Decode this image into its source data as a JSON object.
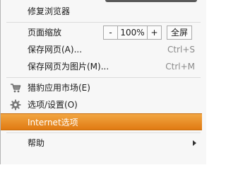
{
  "menu": {
    "repair_browser": "修复浏览器",
    "zoom": {
      "label": "页面缩放",
      "minus": "-",
      "value": "100%",
      "plus": "+",
      "fullscreen": "全屏"
    },
    "save_page": {
      "label": "保存网页(A)...",
      "shortcut": "Ctrl+S"
    },
    "save_as_image": {
      "label": "保存网页为图片(M)...",
      "shortcut": "Ctrl+M"
    },
    "app_market": {
      "label": "猎豹应用市场(E)",
      "icon": "cart-icon"
    },
    "options": {
      "label": "选项/设置(O)",
      "icon": "gear-icon"
    },
    "internet_options": {
      "label": "Internet选项"
    },
    "help": {
      "label": "帮助"
    }
  },
  "colors": {
    "highlight": "#e88a20",
    "menu_bg": "#f7f7f7"
  }
}
